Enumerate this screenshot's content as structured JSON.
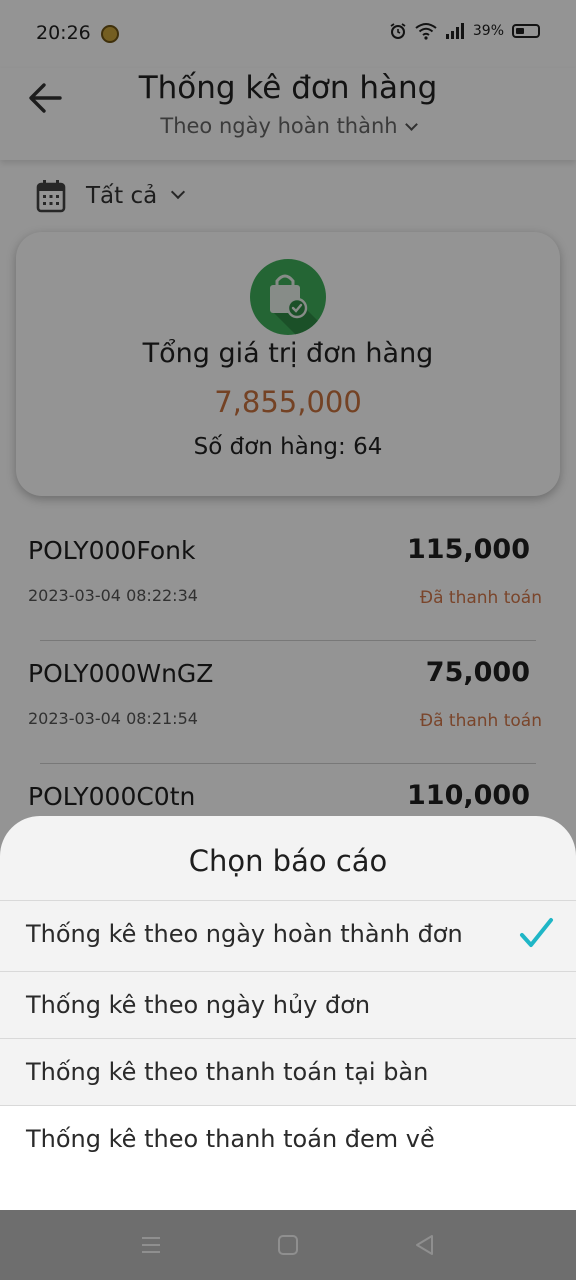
{
  "status_bar": {
    "time": "20:26",
    "battery": "39%"
  },
  "header": {
    "title": "Thống kê đơn hàng",
    "subtitle": "Theo ngày hoàn thành"
  },
  "filter": {
    "label": "Tất cả"
  },
  "summary": {
    "label": "Tổng giá trị đơn hàng",
    "total": "7,855,000",
    "count_text": "Số đơn hàng: 64"
  },
  "orders": [
    {
      "code": "POLY000Fonk",
      "amount": "115,000",
      "date": "2023-03-04 08:22:34",
      "status": "Đã thanh toán"
    },
    {
      "code": "POLY000WnGZ",
      "amount": "75,000",
      "date": "2023-03-04 08:21:54",
      "status": "Đã thanh toán"
    },
    {
      "code": "POLY000C0tn",
      "amount": "110,000",
      "date": "",
      "status": ""
    }
  ],
  "sheet": {
    "title": "Chọn báo cáo",
    "options": [
      {
        "label": "Thống kê theo ngày hoàn thành đơn",
        "selected": true
      },
      {
        "label": "Thống kê theo ngày hủy đơn",
        "selected": false
      },
      {
        "label": "Thống kê theo thanh toán tại bàn",
        "selected": false
      },
      {
        "label": "Thống kê theo thanh toán đem về",
        "selected": false
      }
    ]
  },
  "colors": {
    "accent_check": "#1fb6c6",
    "amount_orange": "#c8733e",
    "status_orange": "#d2784a",
    "icon_green": "#3eaf5a"
  },
  "icons": {
    "back": "arrow-left-icon",
    "calendar": "calendar-icon",
    "bag": "shopping-bag-check-icon",
    "check": "checkmark-icon",
    "nav_menu": "menu-lines-icon",
    "nav_home": "square-home-icon",
    "nav_back": "triangle-back-icon"
  }
}
